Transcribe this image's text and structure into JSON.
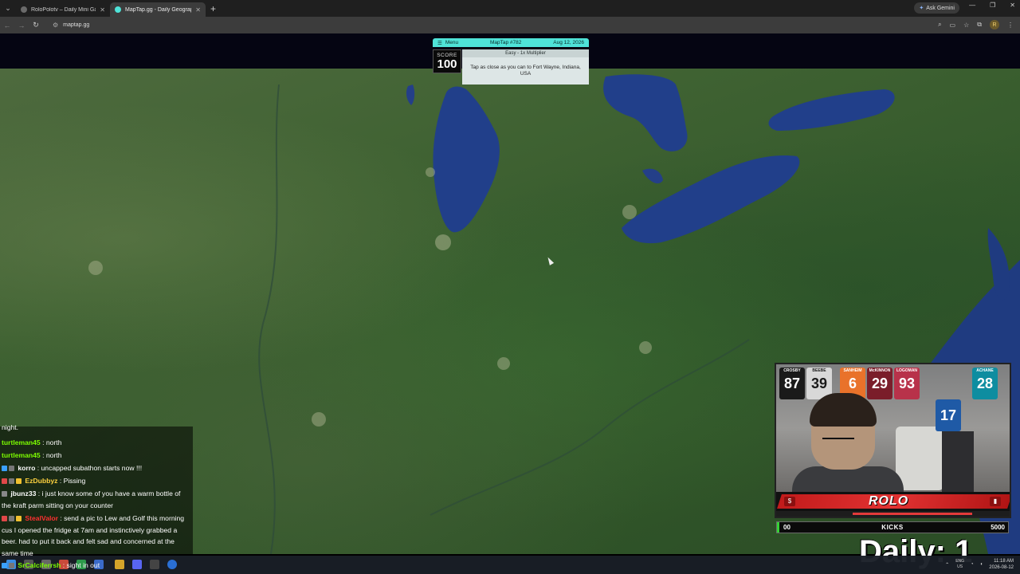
{
  "browser": {
    "tabs": [
      {
        "title": "RoloPolotv – Daily Mini Game !",
        "favicon_color": "#6a6a6a"
      },
      {
        "title": "MapTap.gg - Daily Geography G",
        "favicon_color": "#4fe3d8"
      }
    ],
    "url": "maptap.gg",
    "gemini_label": "Ask Gemini",
    "profile_initial": "R"
  },
  "game": {
    "menu_label": "Menu",
    "puzzle_label": "MapTap #782",
    "date": "Aug 12, 2026",
    "score_label": "SCORE",
    "score_value": "100",
    "multiplier_label": "Easy - 1x Multiplier",
    "prompt": "Tap as close as you can to Fort Wayne, Indiana, USA"
  },
  "chat": {
    "lines": [
      {
        "text": "night."
      },
      {
        "user": "turtleman45",
        "user_color": "#7cfc00",
        "message": " : north"
      },
      {
        "user": "turtleman45",
        "user_color": "#7cfc00",
        "message": " : north"
      },
      {
        "user": "korro",
        "user_color": "#ffffff",
        "message": " : uncapped subathon starts now !!!"
      },
      {
        "user": "EzDubbyz",
        "user_color": "#ffd23f",
        "message": " : Pissing"
      },
      {
        "user": "jbunz33",
        "user_color": "#ffffff",
        "message": " : i just know some of you have a warm bottle of the kraft parm sitting on your counter"
      },
      {
        "user": "StealValor",
        "user_color": "#ff3030",
        "message": " : send a pic to Lew and Golf this morning cus I opened the fridge at 7am and instinctively grabbed a beer. had to put it back and felt sad and concerned at the same time"
      },
      {
        "user": "SrCalciferrsh",
        "user_color": "#7cfc00",
        "message": " : sight in out"
      }
    ]
  },
  "stream": {
    "jerseys": [
      {
        "name": "CROSBY",
        "number": "87",
        "color": "#1a1a1a"
      },
      {
        "name": "BEEBE",
        "number": "39",
        "color": "#d8d8d8"
      },
      {
        "name": "SANHEIM",
        "number": "6",
        "color": "#e9722a"
      },
      {
        "name": "McKINNON",
        "number": "29",
        "color": "#7a1d2a"
      },
      {
        "name": "LOGOMAN",
        "number": "93",
        "color": "#b8324a"
      },
      {
        "name": "ACHANE",
        "number": "28",
        "color": "#0e8da0"
      },
      {
        "name": "",
        "number": "17",
        "color": "#1f5aa6"
      }
    ],
    "banner_logo": "ROLO",
    "kicks": {
      "current": "00",
      "label": "KICKS",
      "goal": "5000",
      "progress_fraction": 0.005
    },
    "daily_label": "Daily: 1"
  },
  "taskbar": {
    "lang": "ENG",
    "region": "US",
    "time": "11:18 AM",
    "date": "2026-08-12"
  }
}
